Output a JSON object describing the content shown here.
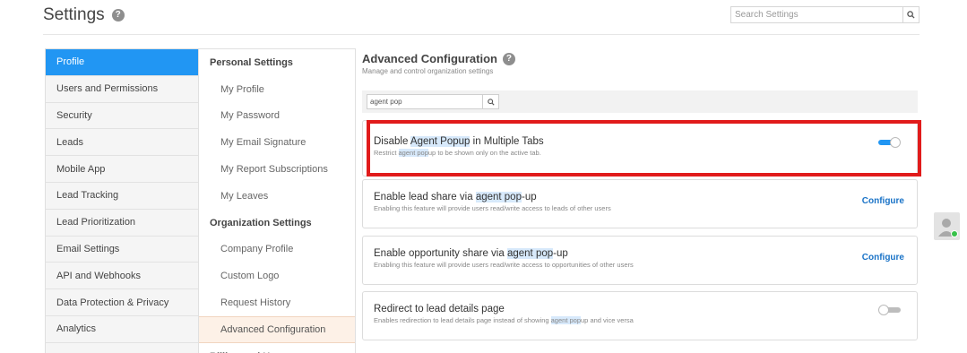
{
  "page": {
    "title": "Settings"
  },
  "search": {
    "placeholder": "Search Settings"
  },
  "left_nav": [
    {
      "label": "Profile",
      "active": true
    },
    {
      "label": "Users and Permissions"
    },
    {
      "label": "Security"
    },
    {
      "label": "Leads"
    },
    {
      "label": "Mobile App"
    },
    {
      "label": "Lead Tracking"
    },
    {
      "label": "Lead Prioritization"
    },
    {
      "label": "Email Settings"
    },
    {
      "label": "API and Webhooks"
    },
    {
      "label": "Data Protection & Privacy"
    },
    {
      "label": "Analytics"
    }
  ],
  "mid_nav": {
    "personal_heading": "Personal Settings",
    "personal_items": [
      "My Profile",
      "My Password",
      "My Email Signature",
      "My Report Subscriptions",
      "My Leaves"
    ],
    "org_heading": "Organization Settings",
    "org_items": [
      "Company Profile",
      "Custom Logo",
      "Request History",
      "Advanced Configuration"
    ],
    "cut_heading": "Billing and Users"
  },
  "content": {
    "title": "Advanced Configuration",
    "subtitle": "Manage and control organization settings",
    "filter_value": "agent pop"
  },
  "cards": [
    {
      "title_parts": [
        "Disable ",
        "Agent Popup",
        " in Multiple Tabs"
      ],
      "desc_parts": [
        "Restrict ",
        "agent pop",
        "up to be shown only on the active tab."
      ],
      "control": "toggle",
      "state": "on"
    },
    {
      "title_parts": [
        "Enable lead share via ",
        "agent pop",
        "-up"
      ],
      "desc_parts": [
        "Enabling this feature will provide users read/write access to leads of other users"
      ],
      "control": "configure",
      "action_label": "Configure"
    },
    {
      "title_parts": [
        "Enable opportunity share via ",
        "agent pop",
        "-up"
      ],
      "desc_parts": [
        "Enabling this feature will provide users read/write access to opportunities of other users"
      ],
      "control": "configure",
      "action_label": "Configure"
    },
    {
      "title_parts": [
        "Redirect to lead details page"
      ],
      "desc_parts": [
        "Enables redirection to lead details page instead of showing ",
        "agent pop",
        "up and vice versa"
      ],
      "control": "toggle",
      "state": "off"
    }
  ],
  "colors": {
    "accent": "#2196f3",
    "highlight": "#d7e9fb",
    "annotation": "#e11b1b",
    "link": "#1a73c7"
  },
  "icons": {
    "help": "help-circle-icon",
    "search": "magnifier-icon",
    "avatar": "user-avatar-icon"
  }
}
